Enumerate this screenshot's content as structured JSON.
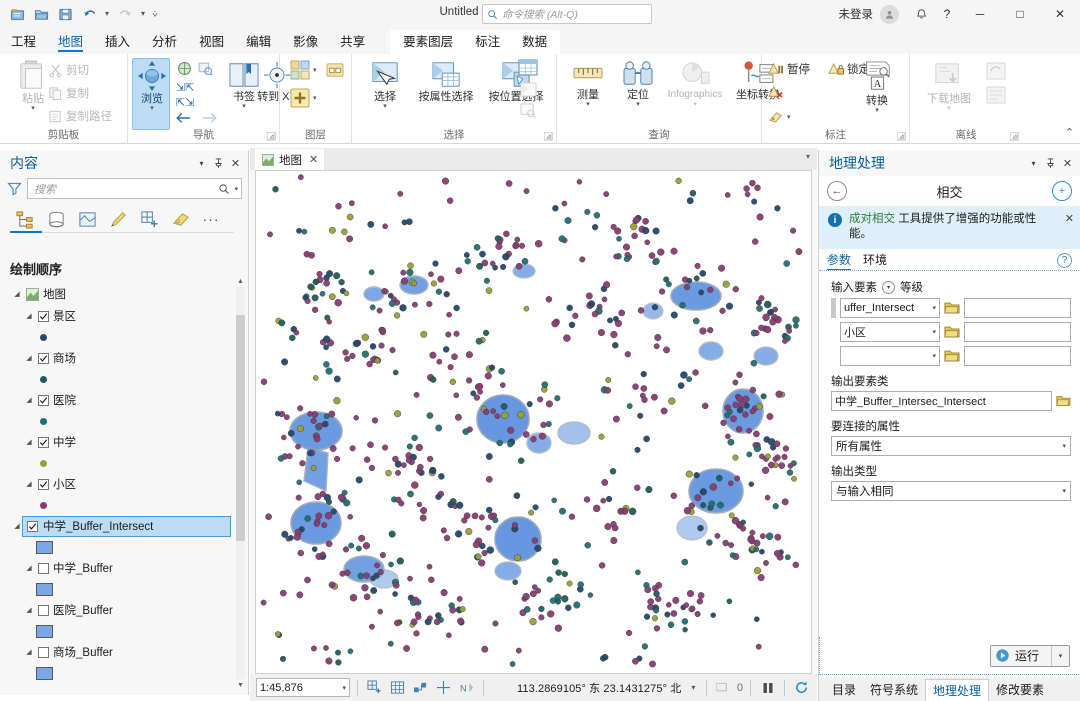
{
  "titlebar": {
    "quick_access": [
      "new-project-icon",
      "open-project-icon",
      "save-project-icon",
      "undo-icon",
      "redo-icon",
      "customize-qat-icon"
    ],
    "document_title": "Untitled",
    "search_placeholder": "命令搜索 (Alt-Q)",
    "sign_in_label": "未登录",
    "help_label": "?",
    "minimize_label": "─",
    "maximize_label": "□",
    "close_label": "✕"
  },
  "ribbon_tabs": {
    "main": [
      "工程",
      "地图",
      "插入",
      "分析",
      "视图",
      "编辑",
      "影像",
      "共享"
    ],
    "active": "地图",
    "contextual": [
      "要素图层",
      "标注",
      "数据"
    ]
  },
  "ribbon_groups": [
    {
      "label": "剪贴板",
      "big": [
        {
          "label": "粘贴",
          "icon": "paste-icon",
          "dropdown": true,
          "disabled": true
        }
      ],
      "small": [
        {
          "label": "剪切",
          "icon": "cut-icon",
          "disabled": true
        },
        {
          "label": "复制",
          "icon": "copy-icon",
          "disabled": true
        },
        {
          "label": "复制路径",
          "icon": "copy-path-icon",
          "disabled": true
        }
      ]
    },
    {
      "label": "导航",
      "big": [
        {
          "label": "浏览",
          "icon": "explore-icon",
          "dropdown": true,
          "active": true
        },
        {
          "label": "书签",
          "icon": "bookmark-icon",
          "dropdown": true
        },
        {
          "label": "转到 XY",
          "icon": "goto-xy-icon",
          "dropdown": false
        }
      ],
      "extra_icons": [
        "full-extent-icon",
        "previous-extent-icon",
        "fixed-zoom-in-icon",
        "fixed-zoom-out-icon",
        "zoom-to-selection-icon",
        "back-arrow-icon",
        "forward-arrow-icon"
      ],
      "has_dialog_launcher": true
    },
    {
      "label": "图层",
      "small": [
        {
          "label": "",
          "icon": "basemap-icon",
          "dropdown": true
        },
        {
          "label": "",
          "icon": "add-data-icon",
          "dropdown": true
        },
        {
          "label": "",
          "icon": "add-preset-icon"
        }
      ]
    },
    {
      "label": "选择",
      "big": [
        {
          "label": "选择",
          "icon": "select-icon",
          "dropdown": true
        },
        {
          "label": "按属性选择",
          "icon": "select-by-attribute-icon"
        },
        {
          "label": "按位置选择",
          "icon": "select-by-location-icon"
        }
      ],
      "extra_icons": [
        "attribute-table-icon",
        "clear-selection-icon",
        "zoom-to-selection-small-icon"
      ],
      "has_dialog_launcher": true
    },
    {
      "label": "查询",
      "big": [
        {
          "label": "测量",
          "icon": "measure-icon",
          "dropdown": true
        },
        {
          "label": "定位",
          "icon": "locate-icon",
          "dropdown": true
        },
        {
          "label": "Infographics",
          "icon": "infographics-icon",
          "dropdown": true,
          "disabled": true
        },
        {
          "label": "坐标转换",
          "icon": "coordinate-conversion-icon"
        }
      ]
    },
    {
      "label": "标注",
      "small": [
        {
          "label": "暂停",
          "icon": "pause-labels-icon"
        },
        {
          "label": "锁定",
          "icon": "lock-labels-icon"
        },
        {
          "label": "",
          "icon": "remove-labels-icon"
        },
        {
          "label": "",
          "icon": "label-style-icon",
          "dropdown": true
        }
      ],
      "big": [
        {
          "label": "转换",
          "icon": "convert-labels-icon",
          "dropdown": true
        }
      ],
      "has_dialog_launcher": true
    },
    {
      "label": "离线",
      "big": [
        {
          "label": "下载地图",
          "icon": "download-map-icon",
          "dropdown": true,
          "disabled": true
        }
      ],
      "small": [
        {
          "label": "",
          "icon": "sync-icon",
          "disabled": true
        },
        {
          "label": "",
          "icon": "manage-replica-icon",
          "disabled": true
        }
      ],
      "has_dialog_launcher": true
    }
  ],
  "contents_pane": {
    "title": "内容",
    "search_placeholder": "搜索",
    "toolbar_icons": [
      "drawing-order-icon",
      "data-source-icon",
      "selection-icon",
      "editing-icon",
      "snapping-icon",
      "labeling-icon",
      "more-options-icon"
    ],
    "section_header": "绘制顺序",
    "root": {
      "label": "地图",
      "icon": "map-icon"
    },
    "layers": [
      {
        "name": "景区",
        "checked": true,
        "symbol": "point",
        "color": "#24476e"
      },
      {
        "name": "商场",
        "checked": true,
        "symbol": "point",
        "color": "#1d5e5b"
      },
      {
        "name": "医院",
        "checked": true,
        "symbol": "point",
        "color": "#1f6f72"
      },
      {
        "name": "中学",
        "checked": true,
        "symbol": "point",
        "color": "#9aa035"
      },
      {
        "name": "小区",
        "checked": true,
        "symbol": "point",
        "color": "#8a3c72"
      },
      {
        "name": "中学_Buffer_Intersect",
        "checked": true,
        "selected": true,
        "symbol": "polygon",
        "color": "#7ba7e8"
      },
      {
        "name": "中学_Buffer",
        "checked": false,
        "symbol": "polygon",
        "color": "#7ba7e8"
      },
      {
        "name": "医院_Buffer",
        "checked": false,
        "symbol": "polygon",
        "color": "#7ba7e8"
      },
      {
        "name": "商场_Buffer",
        "checked": false,
        "symbol": "polygon",
        "color": "#7ba7e8"
      }
    ]
  },
  "map_view": {
    "tab_label": "地图",
    "tab_close": "✕",
    "scale": "1:45,876",
    "coordinates": "113.2869105° 东  23.1431275° 北",
    "selection_count": "0",
    "status_icons": [
      "create-grid-icon",
      "table-icon",
      "snapping-icon",
      "crosshair-icon",
      "north-icon",
      "selection-count-icon",
      "pause-drawing-icon",
      "refresh-icon"
    ]
  },
  "geoprocessing": {
    "title": "地理处理",
    "tool_name": "相交",
    "back_icon": "back-arrow-icon",
    "add_icon": "plus-icon",
    "message": {
      "highlight": "成对相交",
      "text": " 工具提供了增强的功能或性能。"
    },
    "tabs": [
      "参数",
      "环境"
    ],
    "active_tab": "参数",
    "fields": {
      "input_features_label": "输入要素",
      "rank_label": "等级",
      "input_rows": [
        {
          "value": "uffer_Intersect",
          "rank": ""
        },
        {
          "value": "小区",
          "rank": ""
        },
        {
          "value": "",
          "rank": ""
        }
      ],
      "output_label": "输出要素类",
      "output_value": "中学_Buffer_Intersec_Intersect",
      "join_attributes_label": "要连接的属性",
      "join_attributes_value": "所有属性",
      "output_type_label": "输出类型",
      "output_type_value": "与输入相同"
    },
    "run_label": "运行",
    "bottom_tabs": [
      "目录",
      "符号系统",
      "地理处理",
      "修改要素"
    ],
    "active_bottom_tab": "地理处理"
  },
  "colors": {
    "accent": "#0a78d7",
    "link": "#0a64a4",
    "buffer_fill": "#2b6fd4",
    "point_xiaoqu": "#8a3c72",
    "point_yiyuan": "#1f6f72",
    "point_zhongxue": "#9aa035",
    "point_jingqu": "#24476e"
  }
}
